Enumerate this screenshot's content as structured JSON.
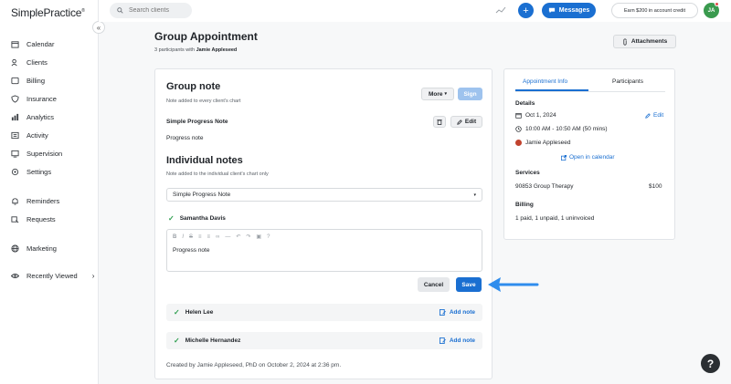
{
  "app": {
    "logo": "SimplePractice",
    "logo_mark": "®"
  },
  "sidebar": {
    "collapse_icon": "«",
    "items": [
      {
        "label": "Calendar",
        "icon": "calendar-icon"
      },
      {
        "label": "Clients",
        "icon": "clients-icon"
      },
      {
        "label": "Billing",
        "icon": "billing-icon"
      },
      {
        "label": "Insurance",
        "icon": "shield-icon"
      },
      {
        "label": "Analytics",
        "icon": "analytics-icon"
      },
      {
        "label": "Activity",
        "icon": "activity-icon"
      },
      {
        "label": "Supervision",
        "icon": "supervision-icon"
      },
      {
        "label": "Settings",
        "icon": "gear-icon"
      },
      {
        "label": "Reminders",
        "icon": "bell-icon"
      },
      {
        "label": "Requests",
        "icon": "requests-icon"
      },
      {
        "label": "Marketing",
        "icon": "globe-icon"
      },
      {
        "label": "Recently Viewed",
        "icon": "eye-icon"
      }
    ],
    "chevron": "›"
  },
  "topbar": {
    "search_placeholder": "Search clients",
    "plus": "+",
    "messages_label": "Messages",
    "earn_label": "Earn $200 in account credit",
    "avatar_initials": "JA"
  },
  "header": {
    "title": "Group Appointment",
    "subtitle_prefix": "3 participants with",
    "subtitle_name": "Jamie Appleseed",
    "attachments_label": "Attachments"
  },
  "group_note": {
    "title": "Group note",
    "caption": "Note added to every client's chart",
    "more_label": "More",
    "sign_label": "Sign",
    "template_name": "Simple Progress Note",
    "edit_label": "Edit",
    "body": "Progress note"
  },
  "individual": {
    "title": "Individual notes",
    "caption": "Note added to the individual client's chart only",
    "selected_template": "Simple Progress Note",
    "active_client": "Samantha Davis",
    "editor_text": "Progress note",
    "toolbar": [
      "B",
      "I",
      "S",
      "≡",
      "≡",
      "∞",
      "—",
      "↶",
      "↷",
      "▣",
      "?"
    ],
    "cancel_label": "Cancel",
    "save_label": "Save",
    "others": [
      {
        "name": "Helen Lee",
        "action": "Add note"
      },
      {
        "name": "Michelle Hernandez",
        "action": "Add note"
      }
    ],
    "footer": "Created by Jamie Appleseed, PhD on October 2, 2024 at 2:36 pm."
  },
  "panel": {
    "tabs": [
      "Appointment Info",
      "Participants"
    ],
    "details_heading": "Details",
    "edit_label": "Edit",
    "date": "Oct 1, 2024",
    "time": "10:00 AM - 10:50 AM (50 mins)",
    "clinician": "Jamie Appleseed",
    "calendar_link": "Open in calendar",
    "services_heading": "Services",
    "service_name": "90853 Group Therapy",
    "service_price": "$100",
    "billing_heading": "Billing",
    "billing_status": "1 paid, 1 unpaid, 1 uninvoiced"
  },
  "help_label": "?",
  "colors": {
    "accent": "#1a6fd1",
    "success": "#2e9e4f",
    "avatar": "#3a9a4e"
  }
}
